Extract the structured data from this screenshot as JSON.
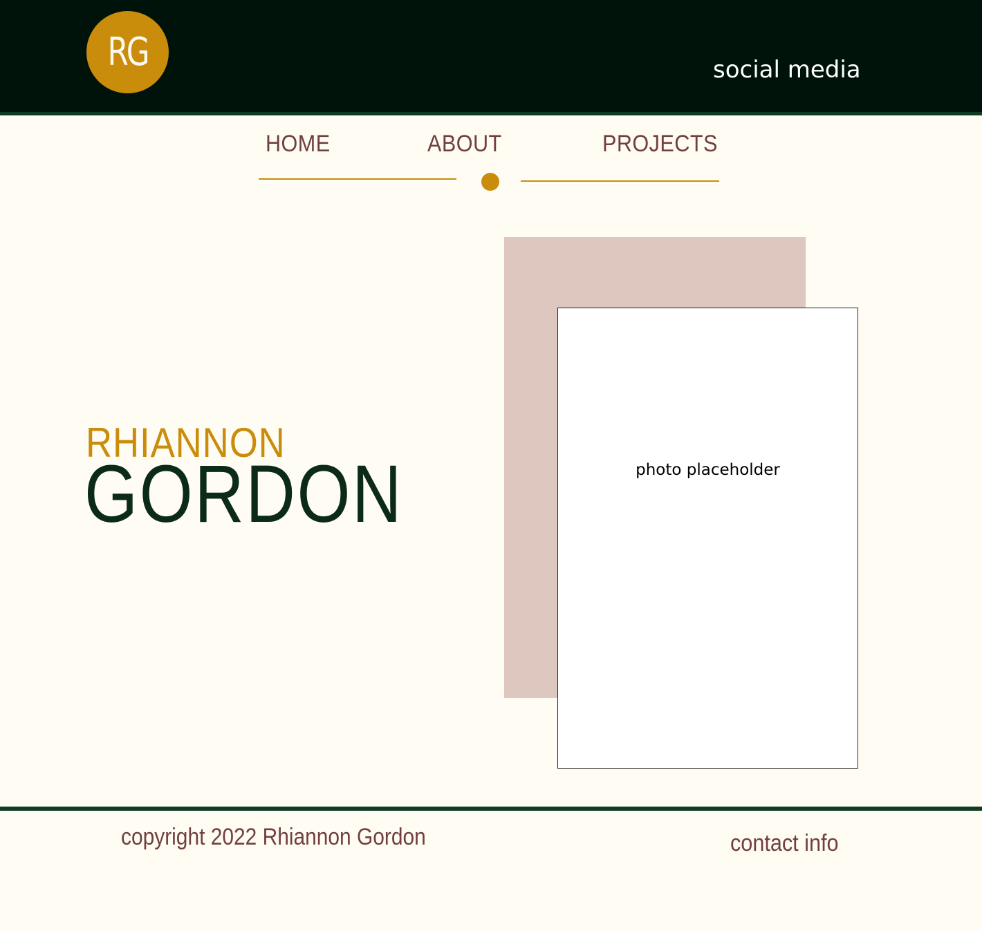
{
  "header": {
    "logo_text": "RG",
    "social_label": "social media"
  },
  "nav": {
    "items": [
      {
        "label": "HOME"
      },
      {
        "label": "ABOUT"
      },
      {
        "label": "PROJECTS"
      }
    ]
  },
  "hero": {
    "first_name": "RHIANNON",
    "last_name": "GORDON",
    "photo_label": "photo placeholder"
  },
  "footer": {
    "copyright": "copyright 2022 Rhiannon Gordon",
    "contact_label": "contact info"
  },
  "colors": {
    "header_bg": "#00130a",
    "accent_gold": "#c98d0b",
    "text_maroon": "#713f3f",
    "dark_green": "#0b2a18",
    "page_bg": "#fffcf3",
    "photo_backdrop": "#dec7be"
  }
}
